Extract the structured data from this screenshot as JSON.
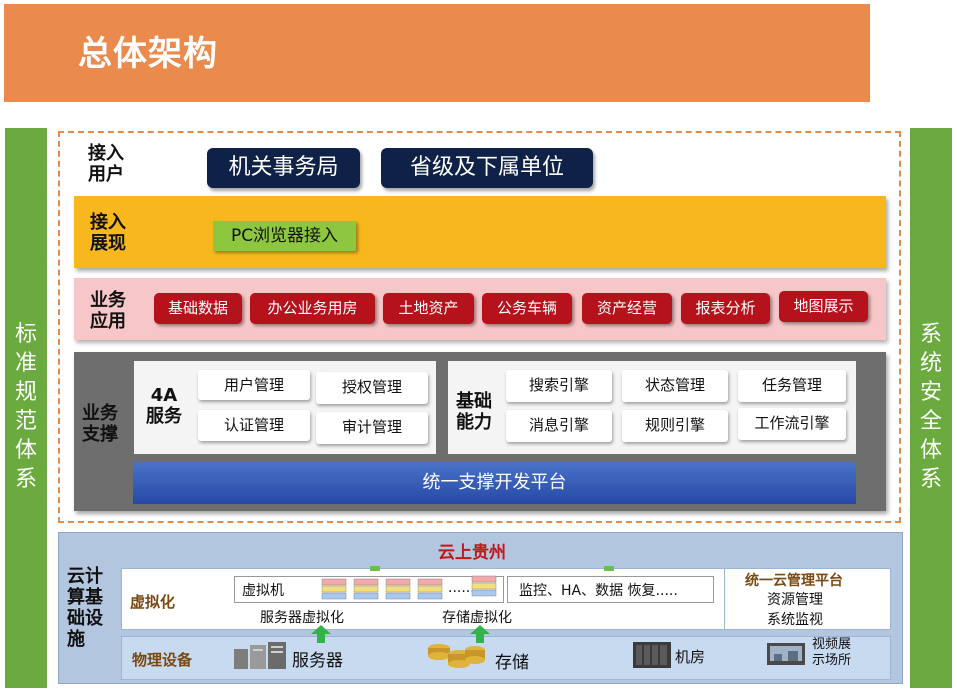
{
  "title": "总体架构",
  "left_side": [
    "标",
    "准",
    "规",
    "范",
    "体",
    "系"
  ],
  "right_side": [
    "系",
    "统",
    "安",
    "全",
    "体",
    "系"
  ],
  "access_users": {
    "label_lines": [
      "接入",
      "用户"
    ],
    "items": [
      "机关事务局",
      "省级及下属单位"
    ]
  },
  "access_display": {
    "label_lines": [
      "接入",
      "展现"
    ],
    "items": [
      "PC浏览器接入"
    ]
  },
  "business_app": {
    "label_lines": [
      "业务",
      "应用"
    ],
    "items": [
      "基础数据",
      "办公业务用房",
      "土地资产",
      "公务车辆",
      "资产经营",
      "报表分析",
      "地图展示"
    ]
  },
  "business_support": {
    "label_lines": [
      "业务",
      "支撑"
    ],
    "service_4a": {
      "label_lines": [
        "4A",
        "服务"
      ],
      "items": [
        "用户管理",
        "授权管理",
        "认证管理",
        "审计管理"
      ]
    },
    "base_ability": {
      "label_lines": [
        "基础",
        "能力"
      ],
      "items": [
        "搜索引擎",
        "状态管理",
        "任务管理",
        "消息引擎",
        "规则引擎",
        "工作流引擎"
      ]
    },
    "platform": "统一支撑开发平台"
  },
  "infrastructure": {
    "label_lines": [
      "云计",
      "算基",
      "础设",
      "施"
    ],
    "cloud_title": "云上贵州",
    "virtualization_label": "虚拟化",
    "vm_label": "虚拟机",
    "vm_dots": "......",
    "monitor_text": "监控、HA、数据 恢复.....",
    "server_virt": "服务器虚拟化",
    "storage_virt": "存储虚拟化",
    "mgmt_title": "统一云管理平台",
    "mgmt_items": [
      "资源管理",
      "系统监视"
    ],
    "physical_label": "物理设备",
    "server": "服务器",
    "storage": "存储",
    "machine_room": "机房",
    "exhibit_lines": [
      "视频展",
      "示场所"
    ]
  }
}
